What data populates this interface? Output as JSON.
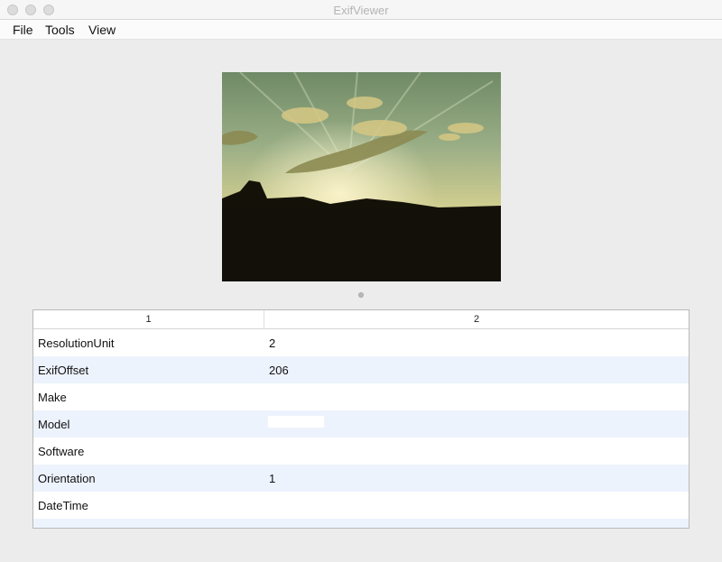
{
  "window": {
    "title": "ExifViewer"
  },
  "menubar": {
    "items": [
      "File",
      "Tools",
      "View"
    ]
  },
  "table": {
    "columns": [
      "1",
      "2"
    ],
    "rows": [
      {
        "key": "ResolutionUnit",
        "value": "2"
      },
      {
        "key": "ExifOffset",
        "value": "206"
      },
      {
        "key": "Make",
        "value": ""
      },
      {
        "key": "Model",
        "value": ""
      },
      {
        "key": "Software",
        "value": ""
      },
      {
        "key": "Orientation",
        "value": "1"
      },
      {
        "key": "DateTime",
        "value": ""
      }
    ]
  },
  "colors": {
    "window_bg": "#ececec",
    "row_alt": "#edf3fd",
    "title_text": "#b4b4b4"
  }
}
